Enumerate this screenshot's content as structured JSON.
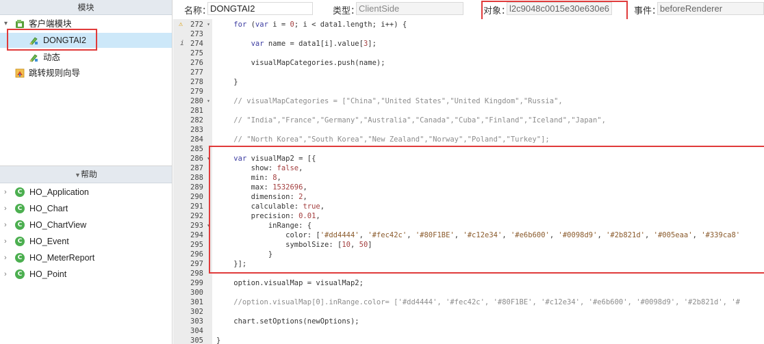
{
  "sidebar": {
    "modules_header": "模块",
    "tree": [
      {
        "label": "客户端模块",
        "expanded": true
      },
      {
        "label": "DONGTAI2",
        "selected": true
      },
      {
        "label": "动态"
      },
      {
        "label": "跳转规则向导"
      }
    ],
    "help_header": "帮助",
    "help_items": [
      "HO_Application",
      "HO_Chart",
      "HO_ChartView",
      "HO_Event",
      "HO_MeterReport",
      "HO_Point"
    ]
  },
  "header": {
    "name_label": "名称：",
    "name_value": "DONGTAI2",
    "type_label": "类型：",
    "type_value": "ClientSide",
    "object_label": "对象：",
    "object_value": "l2c9048c0015e30e630e6",
    "event_label": "事件：",
    "event_value": "beforeRenderer"
  },
  "editor": {
    "line_numbers": [
      "272",
      "273",
      "274",
      "275",
      "276",
      "277",
      "278",
      "279",
      "280",
      "281",
      "282",
      "283",
      "284",
      "285",
      "286",
      "287",
      "288",
      "289",
      "290",
      "291",
      "292",
      "293",
      "294",
      "295",
      "296",
      "297",
      "298",
      "299",
      "300",
      "301",
      "302",
      "303",
      "304",
      "305"
    ],
    "lines": [
      "    for (var i = 0; i < data1.length; i++) {",
      "",
      "        var name = data1[i].value[3];",
      "",
      "        visualMapCategories.push(name);",
      "",
      "    }",
      "",
      "    // visualMapCategories = [\"China\",\"United States\",\"United Kingdom\",\"Russia\",",
      "",
      "    // \"India\",\"France\",\"Germany\",\"Australia\",\"Canada\",\"Cuba\",\"Finland\",\"Iceland\",\"Japan\",",
      "",
      "    // \"North Korea\",\"South Korea\",\"New Zealand\",\"Norway\",\"Poland\",\"Turkey\"];",
      "",
      "    var visualMap2 = [{",
      "        show: false,",
      "        min: 8,",
      "        max: 1532696,",
      "        dimension: 2,",
      "        calculable: true,",
      "        precision: 0.01,",
      "            inRange: {",
      "                color: ['#dd4444', '#fec42c', '#80F1BE', '#c12e34', '#e6b600', '#0098d9', '#2b821d', '#005eaa', '#339ca8'",
      "                symbolSize: [10, 50]",
      "            }",
      "    }];",
      "",
      "    option.visualMap = visualMap2;",
      "",
      "    //option.visualMap[0].inRange.color= ['#dd4444', '#fec42c', '#80F1BE', '#c12e34', '#e6b600', '#0098d9', '#2b821d', '#",
      "",
      "    chart.setOptions(newOptions);",
      "",
      "}"
    ]
  },
  "colors": {
    "selection": "#cde8f9",
    "highlight_border": "#e03a3a",
    "header_bg": "#e4e9ef",
    "gutter_bg": "#ececec"
  }
}
